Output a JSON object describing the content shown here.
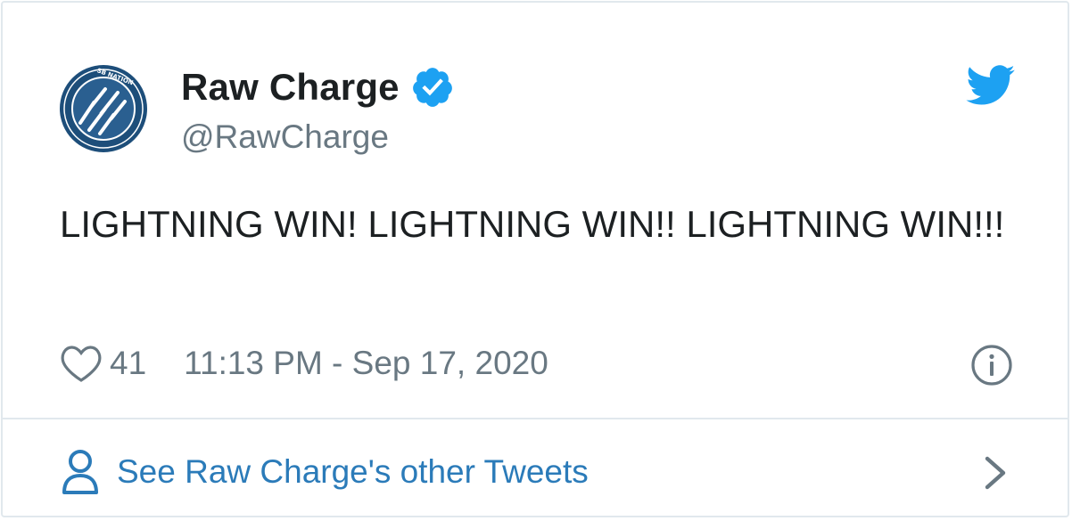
{
  "author": {
    "display_name": "Raw Charge",
    "handle": "@RawCharge",
    "verified": true,
    "avatar_icon": "raw-charge-lightning-logo-icon"
  },
  "tweet": {
    "text": "LIGHTNING WIN! LIGHTNING WIN!! LIGHTNING WIN!!!",
    "like_count": "41",
    "timestamp": "11:13 PM - Sep 17, 2020"
  },
  "footer": {
    "link_text": "See Raw Charge's other Tweets"
  },
  "colors": {
    "twitter_blue": "#1da1f2",
    "link_blue": "#2b7bb9",
    "text_dark": "#1c2022",
    "text_gray": "#697882",
    "border": "#e1e8ed",
    "avatar_navy": "#1d4e7a"
  },
  "icons": [
    "heart-icon",
    "info-icon",
    "twitter-bird-icon",
    "verified-badge-icon",
    "person-icon",
    "chevron-right-icon"
  ]
}
